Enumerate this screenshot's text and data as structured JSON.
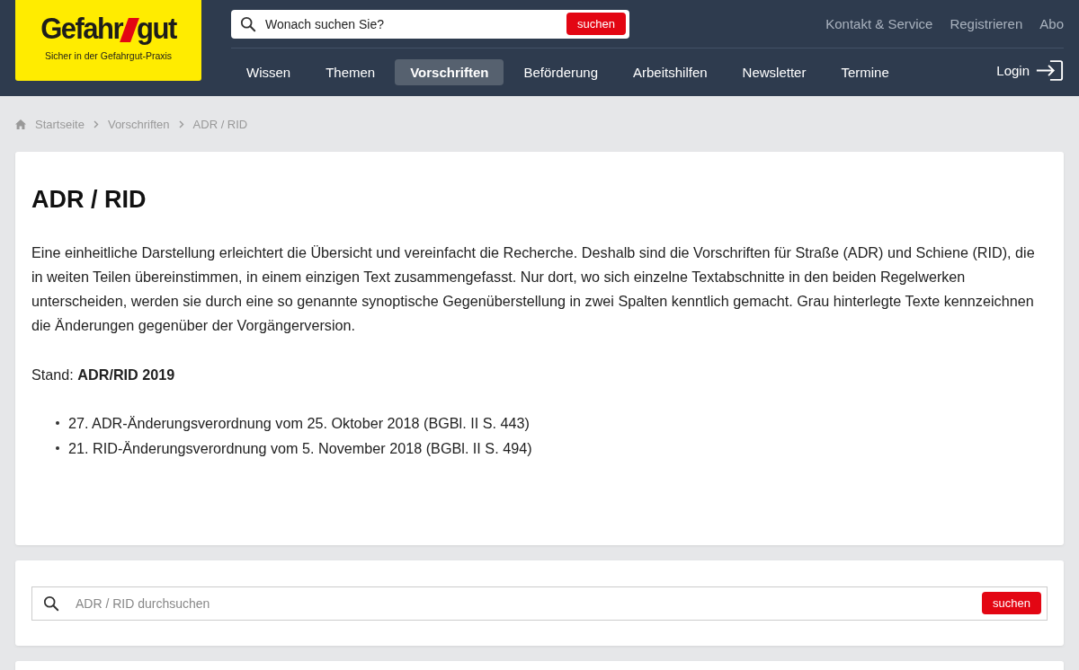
{
  "logo": {
    "word_1": "Gefahr",
    "word_2": "gut",
    "tagline": "Sicher in der Gefahrgut-Praxis"
  },
  "header_search": {
    "placeholder": "Wonach suchen Sie?",
    "button": "suchen"
  },
  "top_links": [
    "Kontakt & Service",
    "Registrieren",
    "Abo"
  ],
  "nav": [
    {
      "label": "Wissen",
      "selected": false
    },
    {
      "label": "Themen",
      "selected": false
    },
    {
      "label": "Vorschriften",
      "selected": true
    },
    {
      "label": "Beförderung",
      "selected": false
    },
    {
      "label": "Arbeitshilfen",
      "selected": false
    },
    {
      "label": "Newsletter",
      "selected": false
    },
    {
      "label": "Termine",
      "selected": false
    }
  ],
  "login": "Login",
  "breadcrumb": [
    "Startseite",
    "Vorschriften",
    "ADR / RID"
  ],
  "article": {
    "title": "ADR / RID",
    "intro": "Eine einheitliche Darstellung erleichtert die Übersicht und vereinfacht die Recherche. Deshalb sind die Vorschriften für Straße (ADR) und Schiene (RID), die in weiten Teilen übereinstimmen, in einem einzigen Text zusammengefasst. Nur dort, wo sich einzelne Textabschnitte in den beiden Regelwerken unterscheiden, werden sie durch eine so genannte synoptische Gegenüberstellung in zwei Spalten kenntlich gemacht. Grau hinterlegte Texte kennzeichnen die Änderungen gegenüber der Vorgängerversion.",
    "status": "Stand: **ADR/RID 2019**",
    "items": [
      "27. ADR-Änderungsverordnung vom 25. Oktober 2018 (BGBl. II S. 443)",
      "21. RID-Änderungsverordnung vom 5. November 2018 (BGBl. II S. 494)"
    ]
  },
  "content_search": {
    "placeholder": "ADR / RID durchsuchen",
    "button": "suchen"
  }
}
